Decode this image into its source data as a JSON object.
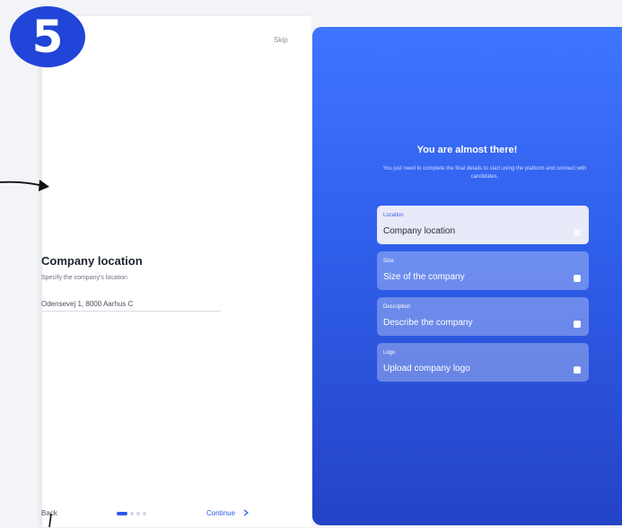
{
  "step_badge": "5",
  "left": {
    "skip": "Skip",
    "title": "Company location",
    "subtitle": "Specify the company's location",
    "address_value": "Odensevej 1, 8000 Aarhus C",
    "back": "Back",
    "continue": "Continue",
    "continue_icon": "chevron-right-icon",
    "pager": {
      "current": 1,
      "total": 4
    }
  },
  "right": {
    "title": "You are almost there!",
    "subtitle": "You just need to complete the final details to start using the platform and connect with candidates.",
    "cards": [
      {
        "label": "Location",
        "value": "Company location",
        "active": true
      },
      {
        "label": "Size",
        "value": "Size of the company",
        "active": false
      },
      {
        "label": "Description",
        "value": "Describe the company",
        "active": false
      },
      {
        "label": "Logo",
        "value": "Upload company logo",
        "active": false
      }
    ]
  },
  "colors": {
    "accent": "#2f58e8",
    "badge": "#2145d8",
    "panel_top": "#3f75ff",
    "panel_bottom": "#2443c6"
  }
}
